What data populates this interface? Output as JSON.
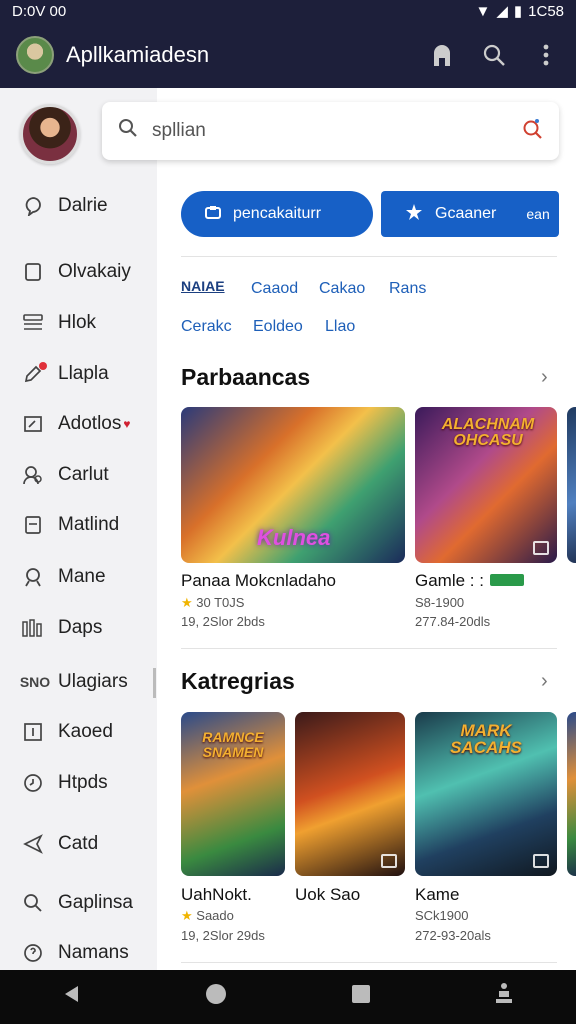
{
  "status": {
    "time": "D:0V 00",
    "right_text": "1C58"
  },
  "appbar": {
    "title": "Apllkamiadesn",
    "icons": [
      "home-icon",
      "search-icon",
      "more-vert-icon"
    ]
  },
  "search": {
    "placeholder": "spllian"
  },
  "sidebar": {
    "items": [
      {
        "label": "Dalrie",
        "icon": "chat-bubble-icon"
      },
      {
        "label": "Olvakaiy",
        "icon": "square-icon"
      },
      {
        "label": "Hlok",
        "icon": "list-icon"
      },
      {
        "label": "Llapla",
        "icon": "edit-icon"
      },
      {
        "label": "Adotlos",
        "icon": "mail-edit-icon"
      },
      {
        "label": "Carlut",
        "icon": "people-icon"
      },
      {
        "label": "Matlind",
        "icon": "document-icon"
      },
      {
        "label": "Mane",
        "icon": "person-icon"
      },
      {
        "label": "Daps",
        "icon": "bar-chart-icon"
      },
      {
        "label": "Ulagiars",
        "icon_text": "SNO"
      },
      {
        "label": "Kaoed",
        "icon": "calendar-icon"
      },
      {
        "label": "Htpds",
        "icon": "clock-icon"
      },
      {
        "label": "Catd",
        "icon": "send-icon"
      },
      {
        "label": "Gaplinsa",
        "icon": "search-icon"
      },
      {
        "label": "Namans",
        "icon": "help-icon"
      }
    ]
  },
  "main": {
    "pills": [
      {
        "label": "pencakaiturr",
        "icon": "badge-icon"
      },
      {
        "label": "Gcaaner",
        "extra": "ean",
        "icon": "tool-icon"
      }
    ],
    "links_row1": [
      "NAIAE",
      "Caaod",
      "Cakao",
      "Rans"
    ],
    "links_row2": [
      "Cerakc",
      "Eoldeo",
      "Llao"
    ],
    "section1": {
      "title": "Parbaancas",
      "cards": [
        {
          "art_text": "Kulnea",
          "title": "Panaa Mokcnladaho",
          "meta1": "30 T0JS",
          "meta2": "19, 2Slor 2bds"
        },
        {
          "art_text": "ALACHNAM OHCASU",
          "title": "Gamle : :",
          "meta1": "S8-1900",
          "meta2": "277.84-20dls"
        }
      ]
    },
    "section2": {
      "title": "Katregrias",
      "cards": [
        {
          "art_text": "RAMNCE SNAMEN",
          "title": "UahNokt.",
          "meta1": "Saado",
          "meta2": "19, 2Slor 29ds"
        },
        {
          "title": "Uok Sao"
        },
        {
          "art_text": "MARK SACAHS",
          "title": "Kame",
          "meta1": "SCk1900",
          "meta2": "272-93-20als"
        }
      ]
    }
  },
  "colors": {
    "appbar_bg": "#1d1f3a",
    "accent": "#1760c6",
    "sidebar_bg": "#f2f2f4",
    "link": "#1e5fb8"
  }
}
